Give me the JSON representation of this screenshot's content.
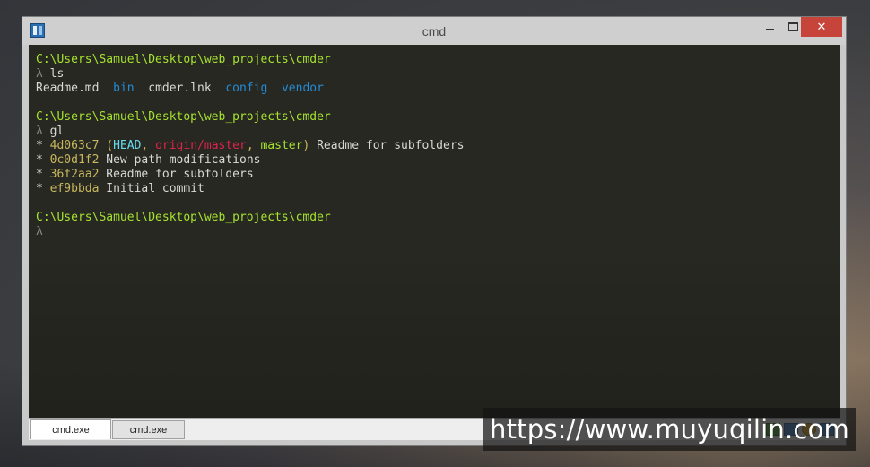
{
  "window": {
    "title": "cmd",
    "close_glyph": "✕"
  },
  "terminal": {
    "block1": {
      "path": "C:\\Users\\Samuel\\Desktop\\web_projects\\cmder",
      "prompt": "λ",
      "command": "ls",
      "files": [
        {
          "name": "Readme.md",
          "color": "#d9d9d5"
        },
        {
          "name": "bin",
          "color": "#268bd2"
        },
        {
          "name": "cmder.lnk",
          "color": "#d9d9d5"
        },
        {
          "name": "config",
          "color": "#268bd2"
        },
        {
          "name": "vendor",
          "color": "#268bd2"
        }
      ]
    },
    "block2": {
      "path": "C:\\Users\\Samuel\\Desktop\\web_projects\\cmder",
      "prompt": "λ",
      "command": "gl",
      "log": [
        {
          "bullet": "*",
          "hash": "4d063c7",
          "refs_open": "(",
          "head": "HEAD",
          "sep1": ", ",
          "origin": "origin/master",
          "sep2": ", ",
          "master": "master",
          "refs_close": ")",
          "message": "Readme for subfolders"
        },
        {
          "bullet": "*",
          "hash": "0c0d1f2",
          "message": "New path modifications"
        },
        {
          "bullet": "*",
          "hash": "36f2aa2",
          "message": "Readme for subfolders"
        },
        {
          "bullet": "*",
          "hash": "ef9bbda",
          "message": "Initial commit"
        }
      ]
    },
    "block3": {
      "path": "C:\\Users\\Samuel\\Desktop\\web_projects\\cmder",
      "prompt": "λ"
    }
  },
  "tabs": [
    {
      "label": "cmd.exe",
      "active": true
    },
    {
      "label": "cmd.exe",
      "active": false
    }
  ],
  "watermark": {
    "text": "https://www.muyuqilin.com"
  },
  "colors": {
    "path": "#a6e22e",
    "dir": "#268bd2",
    "hash": "#c8b75d",
    "head": "#66d9ef",
    "origin": "#e2224e",
    "terminal_bg": "#272822",
    "close_button": "#c7443a"
  }
}
